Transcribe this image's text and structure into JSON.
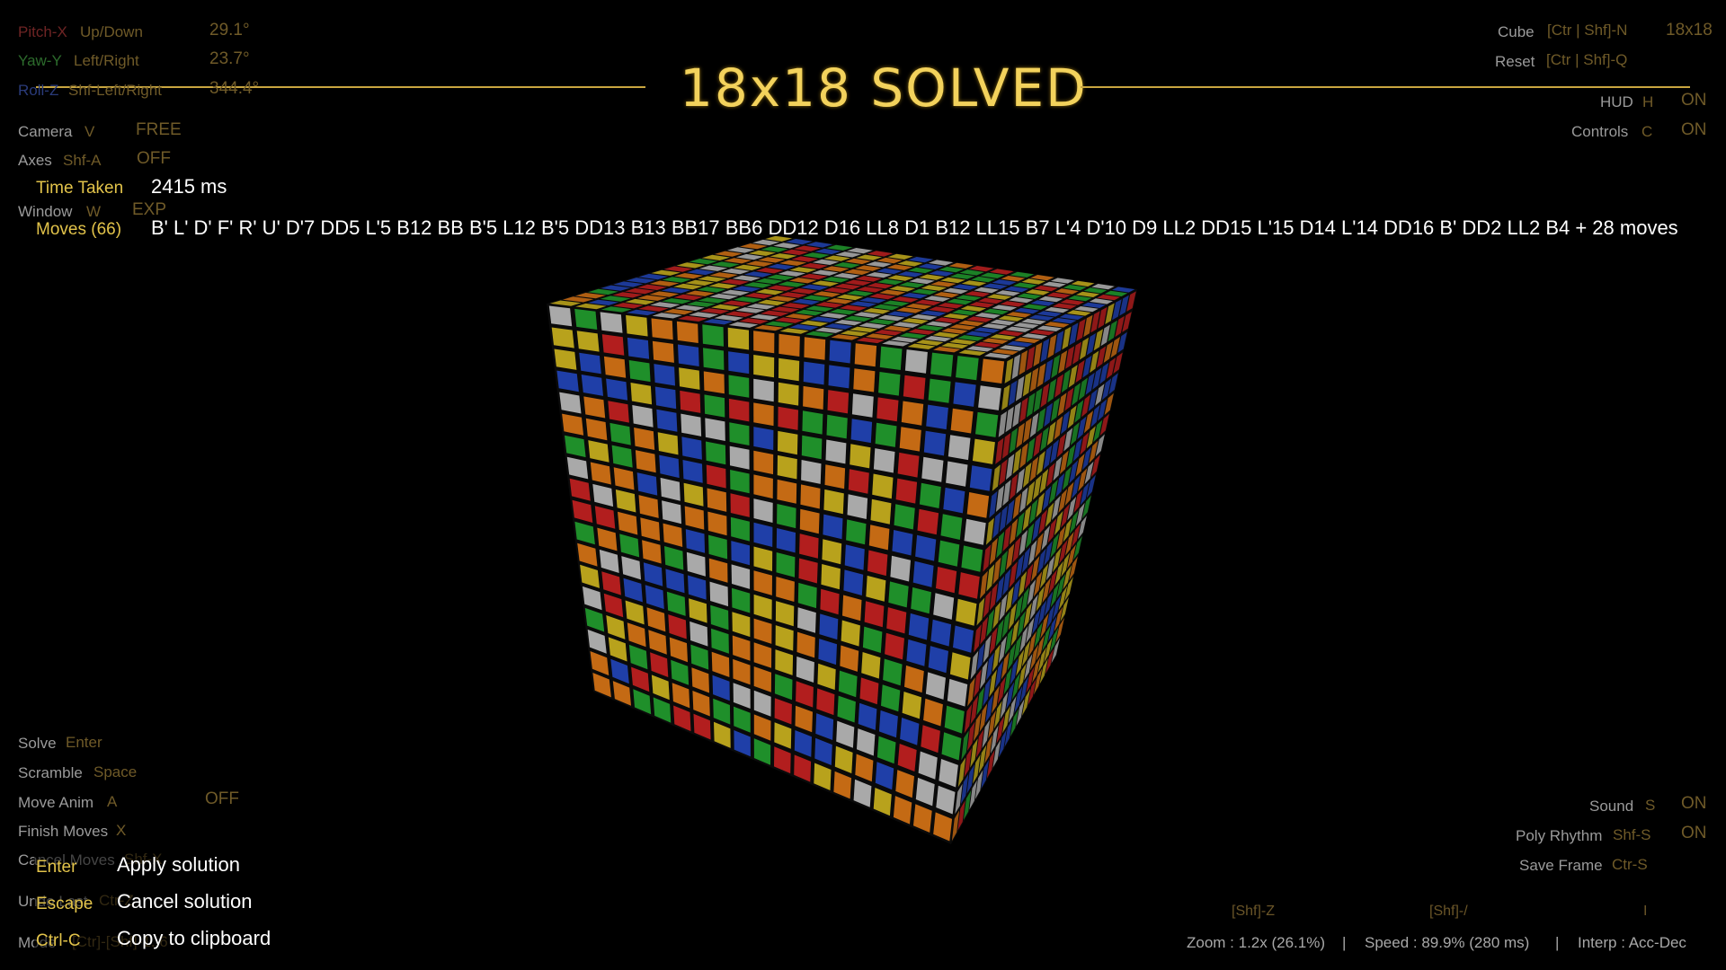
{
  "title": "18x18  SOLVED",
  "top_left": {
    "pitch": {
      "axis": "Pitch-X",
      "label": "Up/Down",
      "value": "29.1°"
    },
    "yaw": {
      "axis": "Yaw-Y",
      "label": "Left/Right",
      "value": "23.7°"
    },
    "roll": {
      "axis": "Roll-Z",
      "label": "Shf-Left/Right",
      "value": "344.4°"
    },
    "camera": {
      "label": "Camera",
      "key": "V",
      "value": "FREE"
    },
    "axes": {
      "label": "Axes",
      "key": "Shf-A",
      "value": "OFF"
    },
    "window": {
      "label": "Window",
      "key": "W",
      "value": "EXP"
    }
  },
  "solution": {
    "time_label": "Time Taken",
    "time_value": "2415  ms",
    "moves_label": "Moves (66)",
    "moves_text": "B' L' D' F' R' U' D'7 DD5 L'5 B12 BB B'5 L12 B'5 DD13 B13 BB17 BB6 DD12 D16 LL8 D1 B12 LL15 B7 L'4 D'10 D9 LL2 DD15 L'15 D14 L'14 DD16 B' DD2 LL2 B4 + 28 moves"
  },
  "top_right": {
    "cube": {
      "label": "Cube",
      "key": "[Ctr | Shf]-N",
      "value": "18x18"
    },
    "reset": {
      "label": "Reset",
      "key": "[Ctr | Shf]-Q"
    },
    "hud": {
      "label": "HUD",
      "key": "H",
      "value": "ON"
    },
    "controls": {
      "label": "Controls",
      "key": "C",
      "value": "ON"
    }
  },
  "bottom_left": {
    "solve": {
      "label": "Solve",
      "key": "Enter"
    },
    "scramble": {
      "label": "Scramble",
      "key": "Space"
    },
    "move_anim": {
      "label": "Move Anim",
      "key": "A",
      "value": "OFF"
    },
    "finish": {
      "label": "Finish Moves",
      "key": "X"
    },
    "cancel": {
      "label": "Cancel Moves",
      "key": "Shf-X"
    },
    "undo": {
      "label": "Undo Last",
      "key": "Ctr-Z"
    },
    "mode": {
      "label": "Mode",
      "key": "[Ctr]-[Shf]-1..6"
    }
  },
  "popup": {
    "items": [
      {
        "key": "Enter",
        "text": "Apply solution"
      },
      {
        "key": "Escape",
        "text": "Cancel solution"
      },
      {
        "key": "Ctrl-C",
        "text": "Copy to clipboard"
      }
    ]
  },
  "bottom_right": {
    "sound": {
      "label": "Sound",
      "key": "S",
      "value": "ON"
    },
    "poly": {
      "label": "Poly Rhythm",
      "key": "Shf-S",
      "value": "ON"
    },
    "save": {
      "label": "Save Frame",
      "key": "Ctr-S"
    }
  },
  "status_bar": {
    "zoom_key": "[Shf]-Z",
    "speed_key": "[Shf]-/",
    "interp_key": "I",
    "zoom": "Zoom : 1.2x (26.1%)",
    "sep1": "|",
    "speed": "Speed : 89.9% (280 ms)",
    "sep2": "|",
    "interp": "Interp : Acc-Dec"
  },
  "cube": {
    "size": 18,
    "colors": [
      "#b21e1e",
      "#1f8f2a",
      "#1f3fa8",
      "#a9a9a9",
      "#c46a14",
      "#b8a21c"
    ]
  }
}
